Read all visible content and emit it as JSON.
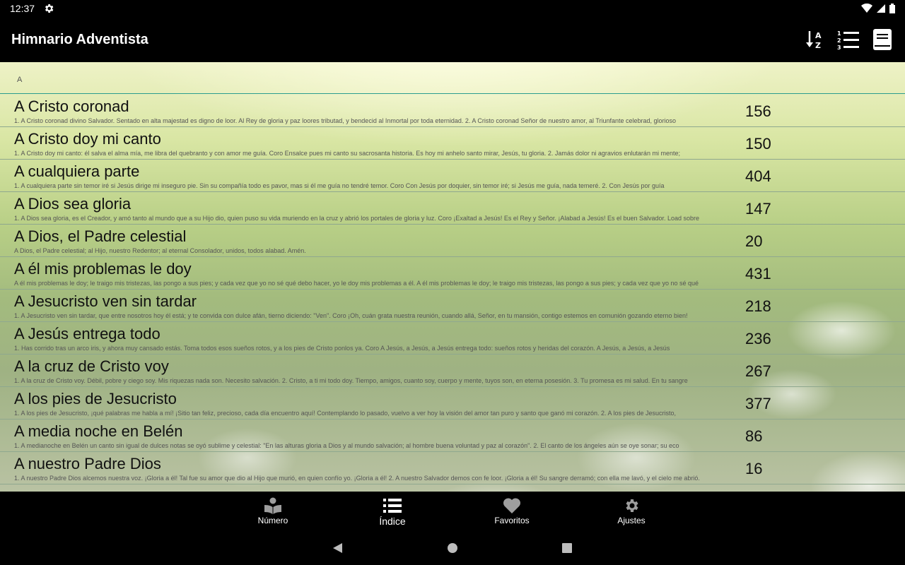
{
  "status": {
    "time": "12:37"
  },
  "app": {
    "title": "Himnario Adventista"
  },
  "section": {
    "letter": "A"
  },
  "hymns": [
    {
      "title": "A Cristo coronad",
      "number": "156",
      "excerpt": "1. A Cristo coronad divino Salvador. Sentado en alta majestad es digno de loor. Al Rey de gloria y paz loores tributad, y bendecid al Inmortal por toda eternidad.  2. A Cristo coronad Señor de nuestro amor, al Triunfante celebrad, glorioso"
    },
    {
      "title": "A Cristo doy mi canto",
      "number": "150",
      "excerpt": "1. A Cristo doy mi canto: él salva el alma mía, me libra del quebranto y con amor me guía.  Coro Ensalce pues mi canto su sacrosanta historia. Es hoy mi anhelo santo mirar, Jesús, tu gloria.  2. Jamás dolor ni agravios enlutarán mi mente;"
    },
    {
      "title": "A cualquiera parte",
      "number": "404",
      "excerpt": "1. A cualquiera parte sin temor iré si Jesús dirige mi inseguro pie. Sin su compañía todo es pavor, mas si él me guía no tendré temor.  Coro Con Jesús por doquier, sin temor iré; si Jesús me guía, nada temeré.  2. Con Jesús por guía"
    },
    {
      "title": "A Dios sea gloria",
      "number": "147",
      "excerpt": "1. A Dios sea gloria, es el Creador, y amó tanto al mundo que a su Hijo dio, quien puso su vida muriendo en la cruz y abrió los portales de gloria y luz.  Coro ¡Exaltad a Jesús! Es el Rey y Señor. ¡Alabad a Jesús! Es el buen Salvador. Load sobre"
    },
    {
      "title": "A Dios, el Padre celestial",
      "number": "20",
      "excerpt": "A Dios, el Padre celestial; al Hijo, nuestro Redentor; al eternal Consolador, unidos, todos alabad. Amén."
    },
    {
      "title": "A él mis problemas le doy",
      "number": "431",
      "excerpt": "A él mis problemas le doy; le traigo mis tristezas, las pongo a sus pies; y cada vez que yo no sé qué debo hacer, yo le doy mis problemas a él. A él mis problemas le doy; le traigo mis tristezas, las pongo a sus pies; y cada vez que yo no sé qué"
    },
    {
      "title": "A Jesucristo ven sin tardar",
      "number": "218",
      "excerpt": "1. A Jesucristo ven sin tardar, que entre nosotros hoy él está; y te convida con dulce afán, tierno diciendo: \"Ven\".  Coro ¡Oh, cuán grata nuestra reunión, cuando allá, Señor, en tu mansión, contigo estemos en comunión gozando eterno bien!"
    },
    {
      "title": "A Jesús entrega todo",
      "number": "236",
      "excerpt": "1. Has corrido tras un arco iris, y ahora muy cansado estás. Toma todos esos sueños rotos, y a los pies de Cristo ponlos ya.  Coro A Jesús, a Jesús, a Jesús entrega todo: sueños rotos y heridas del corazón. A Jesús, a Jesús, a Jesús"
    },
    {
      "title": "A la cruz de Cristo voy",
      "number": "267",
      "excerpt": "1. A la cruz de Cristo voy. Débil, pobre y ciego soy. Mis riquezas nada son. Necesito salvación.  2. Cristo, a ti mi todo doy. Tiempo, amigos, cuanto soy, cuerpo y mente, tuyos son, en eterna posesión.  3. Tu promesa es mi salud. En tu sangre"
    },
    {
      "title": "A los pies de Jesucristo",
      "number": "377",
      "excerpt": "1. A los pies de Jesucristo, ¡qué palabras me habla a mí! ¡Sitio tan feliz, precioso, cada día encuentro aquí! Contemplando lo pasado, vuelvo a ver hoy la visión del amor tan puro y santo que ganó mi corazón.  2. A los pies de Jesucristo,"
    },
    {
      "title": "A media noche en Belén",
      "number": "86",
      "excerpt": "1. A medianoche en Belén un canto sin igual de dulces notas se oyó sublime y celestial: \"En las alturas gloria a Dios y al mundo salvación; al hombre buena voluntad y paz al corazón\".  2. El canto de los ángeles aún se oye sonar; su eco"
    },
    {
      "title": "A nuestro Padre Dios",
      "number": "16",
      "excerpt": "1. A nuestro Padre Dios alcemos nuestra voz. ¡Gloria a él! Tal fue su amor que dio al Hijo que murió, en quien confío yo. ¡Gloria a él!  2. A nuestro Salvador demos con fe loor. ¡Gloria a él! Su sangre derramó; con ella me lavó, y el cielo me abrió."
    }
  ],
  "nav": {
    "numero": "Número",
    "indice": "Índice",
    "favoritos": "Favoritos",
    "ajustes": "Ajustes"
  }
}
